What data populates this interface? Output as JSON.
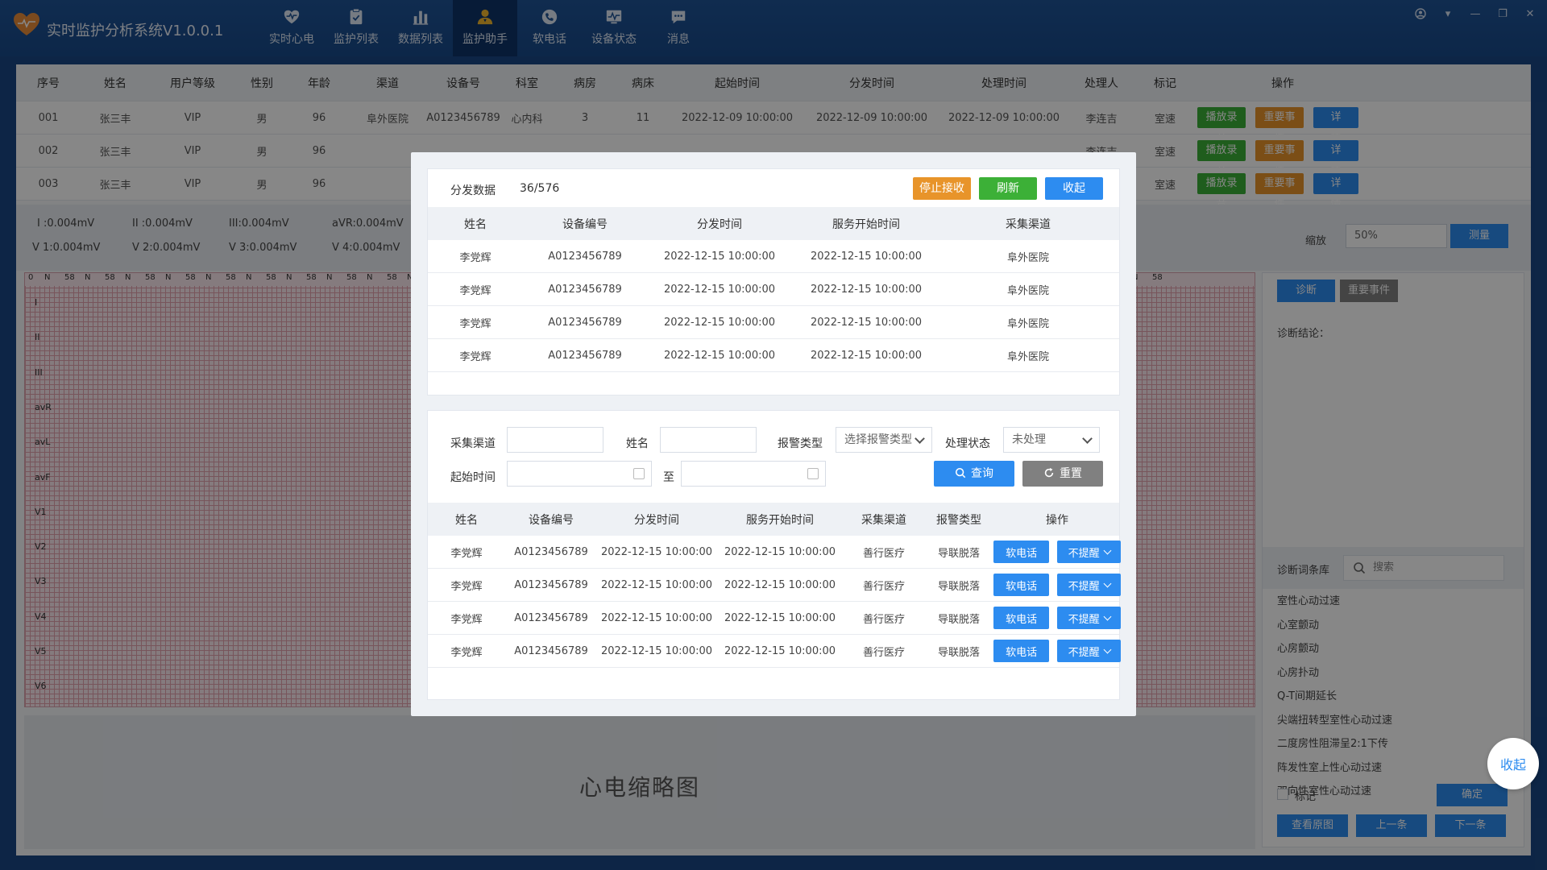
{
  "app": {
    "title": "实时监护分析系统V1.0.0.1"
  },
  "nav": [
    {
      "label": "实时心电",
      "icon": "heart-pulse-icon"
    },
    {
      "label": "监护列表",
      "icon": "clipboard-check-icon"
    },
    {
      "label": "数据列表",
      "icon": "bar-chart-icon"
    },
    {
      "label": "监护助手",
      "icon": "user-assistant-icon",
      "active": true
    },
    {
      "label": "软电话",
      "icon": "phone-icon"
    },
    {
      "label": "设备状态",
      "icon": "monitor-icon"
    },
    {
      "label": "消息",
      "icon": "message-icon"
    }
  ],
  "bg_table": {
    "headers": [
      "序号",
      "姓名",
      "用户等级",
      "性别",
      "年龄",
      "渠道",
      "设备号",
      "科室",
      "病房",
      "病床",
      "起始时间",
      "分发时间",
      "处理时间",
      "处理人",
      "标记",
      "操作"
    ],
    "rows": [
      [
        "001",
        "张三丰",
        "VIP",
        "男",
        "96",
        "阜外医院",
        "A0123456789",
        "心内科",
        "3",
        "11",
        "2022-12-09  10:00:00",
        "2022-12-09  10:00:00",
        "2022-12-09  10:00:00",
        "李连吉",
        "室速"
      ],
      [
        "002",
        "张三丰",
        "VIP",
        "男",
        "96",
        "",
        "",
        "",
        "",
        "",
        "",
        "",
        "",
        "李连吉",
        "室速"
      ],
      [
        "003",
        "张三丰",
        "VIP",
        "男",
        "96",
        "",
        "",
        "",
        "",
        "",
        "",
        "",
        "",
        "李连吉",
        "室速"
      ]
    ],
    "actions": {
      "play": "播放录音",
      "important": "重要事件",
      "detail": "详情"
    }
  },
  "leads_values": [
    "I :0.004mV",
    "II :0.004mV",
    "III:0.004mV",
    "aVR:0.004mV",
    "V 1:0.004mV",
    "V 2:0.004mV",
    "V 3:0.004mV",
    "V 4:0.004mV"
  ],
  "zoom": {
    "label": "缩放",
    "value": "50%",
    "measure": "测量"
  },
  "ecg": {
    "ruler_marks": [
      "0",
      "N",
      "58",
      "N",
      "58",
      "N",
      "58",
      "N",
      "58",
      "N",
      "58",
      "N",
      "58",
      "N",
      "58",
      "N",
      "58",
      "N",
      "58",
      "N",
      "58",
      "N",
      "58",
      "N",
      "58",
      "N",
      "58",
      "N",
      "58",
      "N",
      "58",
      "N",
      "58",
      "N",
      "58",
      "N",
      "58",
      "N",
      "58",
      "N",
      "58",
      "N",
      "58",
      "N",
      "58",
      "N",
      "58",
      "N",
      "58",
      "N",
      "58",
      "N",
      "58",
      "N",
      "58",
      "N",
      "58"
    ],
    "leads": [
      "I",
      "II",
      "III",
      "avR",
      "avL",
      "avF",
      "V1",
      "V2",
      "V3",
      "V4",
      "V5",
      "V6"
    ]
  },
  "thumbnail": {
    "title": "心电缩略图"
  },
  "right_panel": {
    "diagnose": "诊断",
    "important": "重要事件",
    "conclusion_label": "诊断结论：",
    "dict_label": "诊断词条库",
    "search_placeholder": "搜索",
    "diag_items": [
      "室性心动过速",
      "心室颤动",
      "心房颤动",
      "心房扑动",
      "Q-T间期延长",
      "尖端扭转型室性心动过速",
      "二度房性阻滞呈2:1下传",
      "阵发性室上性心动过速",
      "双向性室性心动过速"
    ],
    "mark_label": "标记",
    "confirm": "确定",
    "view_original": "查看原图",
    "prev": "上一条",
    "next": "下一条"
  },
  "modal": {
    "dispatch_label": "分发数据",
    "dispatch_count": "36/576",
    "stop": "停止接收",
    "refresh": "刷新",
    "collapse": "收起",
    "table1": {
      "headers": [
        "姓名",
        "设备编号",
        "分发时间",
        "服务开始时间",
        "采集渠道"
      ],
      "rows": [
        [
          "李党辉",
          "A0123456789",
          "2022-12-15  10:00:00",
          "2022-12-15  10:00:00",
          "阜外医院"
        ],
        [
          "李党辉",
          "A0123456789",
          "2022-12-15  10:00:00",
          "2022-12-15  10:00:00",
          "阜外医院"
        ],
        [
          "李党辉",
          "A0123456789",
          "2022-12-15  10:00:00",
          "2022-12-15  10:00:00",
          "阜外医院"
        ],
        [
          "李党辉",
          "A0123456789",
          "2022-12-15  10:00:00",
          "2022-12-15  10:00:00",
          "阜外医院"
        ]
      ]
    },
    "filter": {
      "channel_label": "采集渠道",
      "name_label": "姓名",
      "alarm_label": "报警类型",
      "alarm_placeholder": "选择报警类型",
      "status_label": "处理状态",
      "status_value": "未处理",
      "start_label": "起始时间",
      "to_label": "至",
      "query": "查询",
      "reset": "重置"
    },
    "table2": {
      "headers": [
        "姓名",
        "设备编号",
        "分发时间",
        "服务开始时间",
        "采集渠道",
        "报警类型",
        "操作"
      ],
      "rows": [
        [
          "李党辉",
          "A0123456789",
          "2022-12-15  10:00:00",
          "2022-12-15  10:00:00",
          "善行医疗",
          "导联脱落"
        ],
        [
          "李党辉",
          "A0123456789",
          "2022-12-15  10:00:00",
          "2022-12-15  10:00:00",
          "善行医疗",
          "导联脱落"
        ],
        [
          "李党辉",
          "A0123456789",
          "2022-12-15  10:00:00",
          "2022-12-15  10:00:00",
          "善行医疗",
          "导联脱落"
        ],
        [
          "李党辉",
          "A0123456789",
          "2022-12-15  10:00:00",
          "2022-12-15  10:00:00",
          "善行医疗",
          "导联脱落"
        ]
      ],
      "call": "软电话",
      "no_remind": "不提醒"
    }
  },
  "float_collapse": "收起",
  "colors": {
    "primary": "#2d8cf0",
    "green": "#3cb037",
    "orange": "#e8942a",
    "gray": "#808080",
    "topbar": "#1f5396"
  }
}
